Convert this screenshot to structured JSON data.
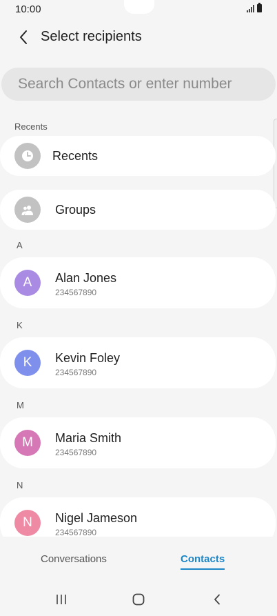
{
  "status_bar": {
    "time": "10:00"
  },
  "header": {
    "title": "Select recipients"
  },
  "search": {
    "placeholder": "Search Contacts or enter number",
    "value": ""
  },
  "sections": {
    "recents_header": "Recents",
    "a": "A",
    "k": "K",
    "m": "M",
    "n": "N"
  },
  "recents": {
    "label": "Recents"
  },
  "groups": {
    "label": "Groups"
  },
  "contacts": [
    {
      "initial": "A",
      "name": "Alan Jones",
      "number": "234567890",
      "color": "#a98be3"
    },
    {
      "initial": "K",
      "name": "Kevin Foley",
      "number": "234567890",
      "color": "#7f8fec"
    },
    {
      "initial": "M",
      "name": "Maria Smith",
      "number": "234567890",
      "color": "#d678b6"
    },
    {
      "initial": "N",
      "name": "Nigel Jameson",
      "number": "234567890",
      "color": "#ef8aa4"
    }
  ],
  "tabs": {
    "conversations": "Conversations",
    "contacts": "Contacts"
  },
  "colors": {
    "accent": "#1a86c8",
    "icon_gray": "#c2c2c2"
  }
}
